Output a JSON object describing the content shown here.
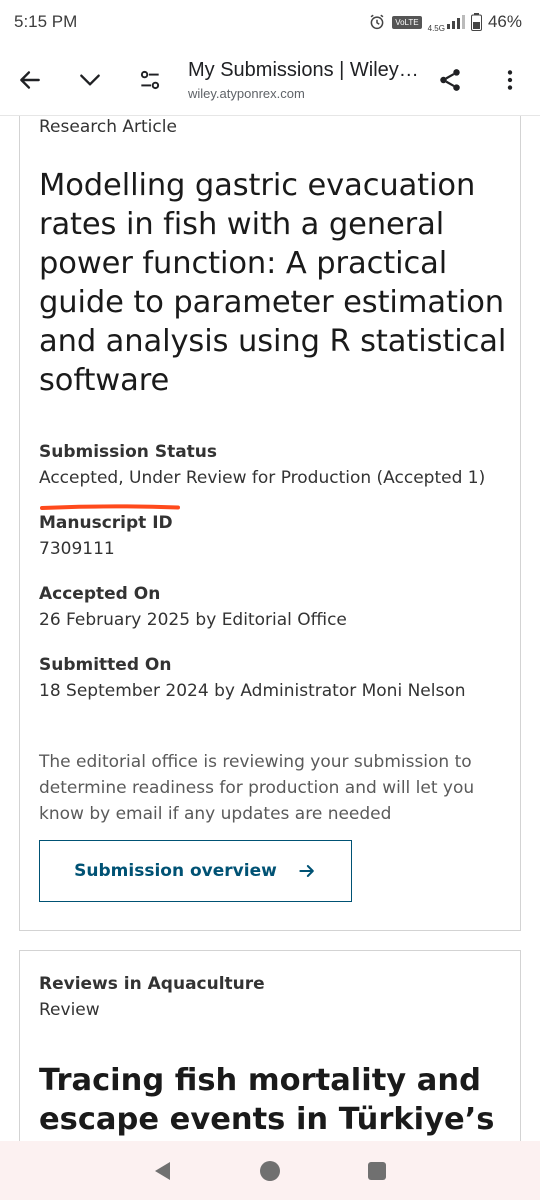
{
  "status_bar": {
    "time": "5:15 PM",
    "volte": "VoLTE",
    "network": "4.5G",
    "battery": "46%"
  },
  "browser": {
    "page_title": "My Submissions | Wiley Au...",
    "url": "wiley.atyponrex.com"
  },
  "submission": {
    "article_type": "Research Article",
    "title": "Modelling gastric evacuation rates in fish with a general power function: A practical guide to parameter estimation and analysis using R statistical software",
    "status_label": "Submission Status",
    "status_value": "Accepted, Under Review for Production (Accepted 1)",
    "manuscript_label": "Manuscript ID",
    "manuscript_value": "7309111",
    "accepted_label": "Accepted On",
    "accepted_value": "26 February 2025 by Editorial Office",
    "submitted_label": "Submitted On",
    "submitted_value": "18 September 2024 by Administrator Moni Nelson",
    "description": "The editorial office is reviewing your submission to determine readiness for production and will let you know by email if any updates are needed",
    "overview_button": "Submission overview",
    "underline_color": "#ff4a1c"
  },
  "second_submission": {
    "journal": "Reviews in Aquaculture",
    "article_type": "Review",
    "title": "Tracing fish mortality and escape events in Türkiye’s"
  },
  "colors": {
    "accent": "#005274",
    "nav_bg": "#fcf1f1"
  }
}
